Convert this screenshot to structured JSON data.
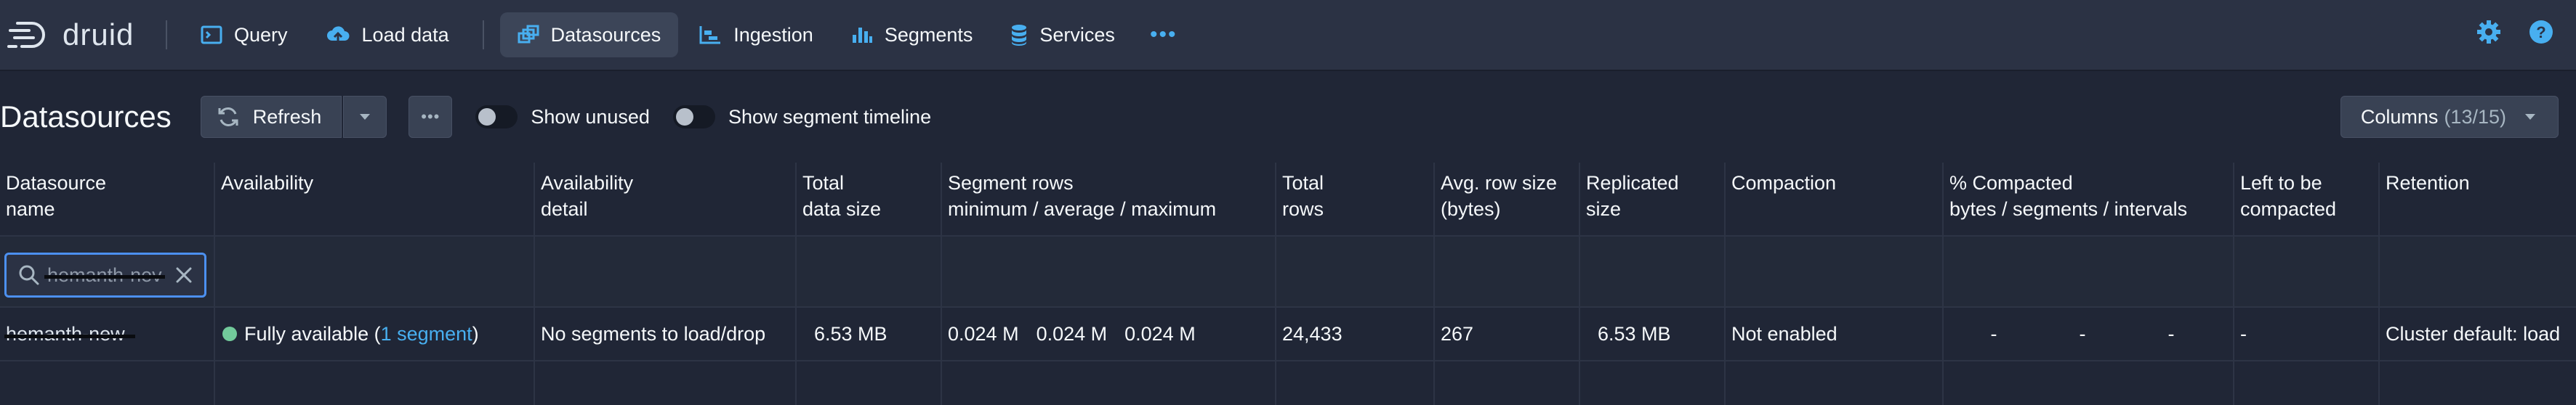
{
  "app": {
    "name": "druid"
  },
  "nav": {
    "items": [
      {
        "label": "Query",
        "icon": "query-icon"
      },
      {
        "label": "Load data",
        "icon": "cloud-upload-icon"
      },
      {
        "label": "Datasources",
        "icon": "datasources-icon",
        "active": true
      },
      {
        "label": "Ingestion",
        "icon": "ingestion-chart-icon"
      },
      {
        "label": "Segments",
        "icon": "segments-icon"
      },
      {
        "label": "Services",
        "icon": "database-icon"
      }
    ],
    "more": "•••"
  },
  "toolbar": {
    "title": "Datasources",
    "refresh_label": "Refresh",
    "more_label": "•••",
    "show_unused_label": "Show unused",
    "show_timeline_label": "Show segment timeline",
    "columns_label": "Columns",
    "columns_count": "(13/15)"
  },
  "table": {
    "headers": {
      "name": [
        "Datasource",
        "name"
      ],
      "availability": [
        "Availability",
        ""
      ],
      "availability_detail": [
        "Availability",
        "detail"
      ],
      "total_size": [
        "Total",
        "data size"
      ],
      "segment_rows": [
        "Segment rows",
        "minimum / average / maximum"
      ],
      "total_rows": [
        "Total",
        "rows"
      ],
      "avg_row": [
        "Avg. row size",
        "(bytes)"
      ],
      "replicated": [
        "Replicated",
        "size"
      ],
      "compaction": [
        "Compaction",
        ""
      ],
      "compacted": [
        "% Compacted",
        "bytes / segments / intervals"
      ],
      "left": [
        "Left to be",
        "compacted"
      ],
      "retention": [
        "Retention",
        ""
      ]
    },
    "filter": {
      "value": "hemanth-nev"
    },
    "rows": [
      {
        "name": "hemanth-new",
        "availability_text": "Fully available (",
        "availability_link": "1 segment",
        "availability_close": ")",
        "availability_detail": "No segments to load/drop",
        "total_size": "6.53 MB",
        "seg_min": "0.024 M",
        "seg_avg": "0.024 M",
        "seg_max": "0.024 M",
        "total_rows": "24,433",
        "avg_row": "267",
        "replicated": "6.53 MB",
        "compaction": "Not enabled",
        "compacted_bytes": "-",
        "compacted_segments": "-",
        "compacted_intervals": "-",
        "left": "-",
        "retention": "Cluster default: load"
      }
    ]
  },
  "colors": {
    "bg": "#202636",
    "topbar": "#2b3244",
    "accent": "#48aff0",
    "status_ok": "#72ca9b"
  }
}
